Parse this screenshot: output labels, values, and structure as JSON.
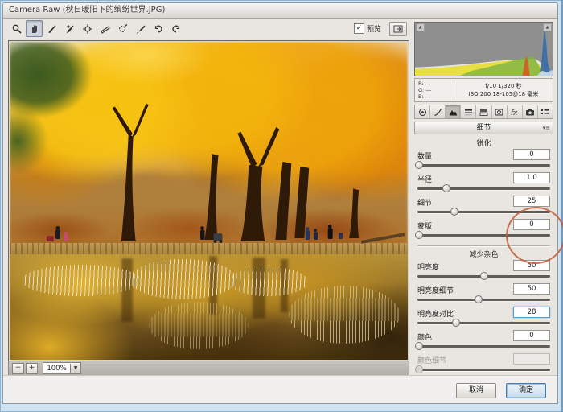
{
  "window": {
    "title": "Camera Raw (秋日暖阳下的缤纷世界.JPG)"
  },
  "toolbar": {
    "preview_label": "预览",
    "preview_check_glyph": "✓"
  },
  "histogram": {
    "rgb": [
      {
        "ch": "R:",
        "val": "---"
      },
      {
        "ch": "G:",
        "val": "---"
      },
      {
        "ch": "B:",
        "val": "---"
      }
    ],
    "exif_line1": "f/10  1/320 秒",
    "exif_line2": "ISO 200  18-105@18 毫米"
  },
  "panel": {
    "title": "细节",
    "menu_glyph": "▾≡",
    "sharpen": {
      "title": "锐化",
      "rows": [
        {
          "label": "数量",
          "value": "0",
          "pos": 1
        },
        {
          "label": "半径",
          "value": "1.0",
          "pos": 22
        },
        {
          "label": "细节",
          "value": "25",
          "pos": 28
        },
        {
          "label": "蒙版",
          "value": "0",
          "pos": 1
        }
      ]
    },
    "noise": {
      "title": "减少杂色",
      "rows": [
        {
          "label": "明亮度",
          "value": "50",
          "pos": 50
        },
        {
          "label": "明亮度细节",
          "value": "50",
          "pos": 46
        },
        {
          "label": "明亮度对比",
          "value": "28",
          "pos": 29
        },
        {
          "label": "颜色",
          "value": "0",
          "pos": 1
        },
        {
          "label": "颜色细节",
          "value": "",
          "pos": 1
        }
      ]
    }
  },
  "footer": {
    "zoom_out": "−",
    "zoom_in": "+",
    "zoom_value": "100%",
    "dropdown_arrow": "▼",
    "cancel_label": "取消",
    "ok_label": "确定"
  },
  "annotation": {
    "color": "#c25a35"
  }
}
